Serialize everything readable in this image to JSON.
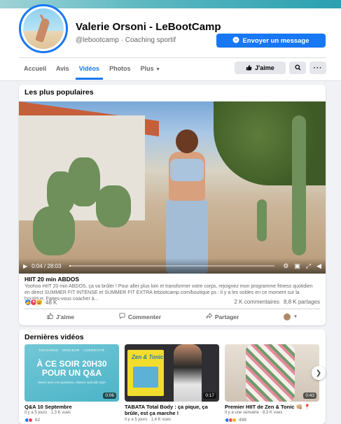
{
  "colors": {
    "accent": "#1877f2",
    "like": "#1877f2",
    "love": "#f33e58",
    "haha": "#f7b125"
  },
  "profile": {
    "name": "Valerie Orsoni - LeBootCamp",
    "handle": "@lebootcamp",
    "category": "Coaching sportif",
    "subtitle": "@lebootcamp · Coaching sportif",
    "message_button": "Envoyer un message"
  },
  "tabs": [
    {
      "label": "Accueil",
      "active": false
    },
    {
      "label": "Avis",
      "active": false
    },
    {
      "label": "Vidéos",
      "active": true
    },
    {
      "label": "Photos",
      "active": false
    },
    {
      "label": "Plus",
      "active": false
    }
  ],
  "page_actions": {
    "like_label": "J'aime",
    "search_icon": "search-icon",
    "more_icon": "more-icon"
  },
  "popular": {
    "section_title": "Les plus populaires",
    "video": {
      "current_time": "0:04",
      "duration": "28:03",
      "time_label": "0:04 / 28:03",
      "progress": 0.002,
      "title": "HIIT 20 min ABDOS",
      "description": "Yoohoo HIIT 20 min ABDOS, ça va brûler ! Pour aller plus loin et transformer votre corps, rejoignez mon programme fitness quotidien en direct SUMMER FIT INTENSE et SUMMER FIT EXTRA lebootcamp.com/boutique ps : il y a les soldes en ce moment sur la boutique. Faites-vous coacher à...",
      "reactions_count": "48 K",
      "comments": "2 K commentaires",
      "shares": "8,8 K partages"
    },
    "actions": {
      "like": "J'aime",
      "comment": "Commenter",
      "share": "Partager"
    }
  },
  "latest": {
    "section_title": "Dernières vidéos",
    "items": [
      {
        "title": "Q&A 10 Septembre",
        "meta": "Il y a 5 jours · 1,3 K vues",
        "duration": "0:06",
        "reactions": "62",
        "thumb_top": "COACHING · MINCEUR · LONGÉVITÉ",
        "thumb_big": "À CE SOIR 20H30 POUR UN Q&A",
        "thumb_sub": "Venez avec vos questions, séance spéciale Q&A"
      },
      {
        "title": "TABATA Total Body : ça pique, ça brûle, est ça marche !",
        "meta": "Il y a 5 jours · 1,4 K vues",
        "duration": "0:17",
        "book_title": "Zen & Tonic"
      },
      {
        "title": "Premier HIIT de Zen & Tonic 👊🏼 📍",
        "meta": "Il y a une semaine · 8,3 K vues",
        "duration": "0:43",
        "reactions": "498"
      }
    ]
  }
}
